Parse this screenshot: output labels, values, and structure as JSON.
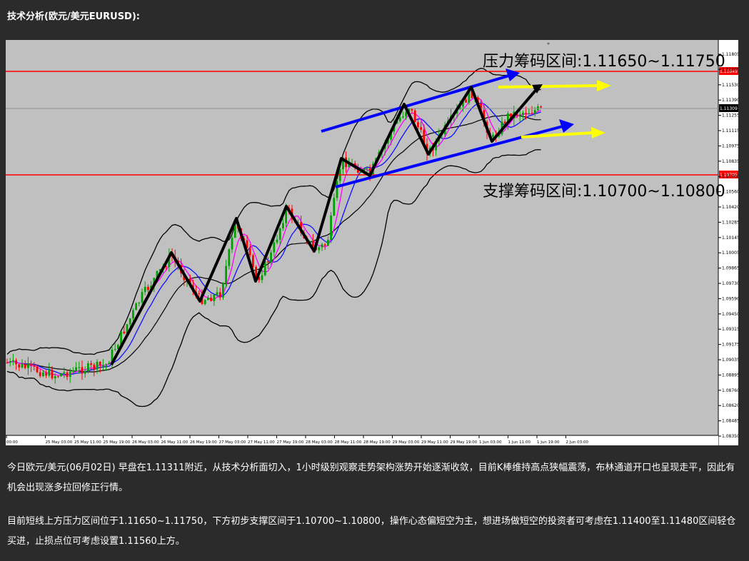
{
  "heading": "技术分析(欧元/美元EURUSD):",
  "chart": {
    "resistance_label": "压力筹码区间:1.11650~1.11750",
    "support_label": "支撑筹码区间:1.10700~1.10800",
    "resistance_level": "1.11649",
    "support_level": "1.10705",
    "current_price": "1.11309",
    "price_ticks": [
      "1.11805",
      "1.11665",
      "1.11530",
      "1.11390",
      "1.11255",
      "1.11115",
      "1.10975",
      "1.10835",
      "1.10700",
      "1.10560",
      "1.10420",
      "1.10285",
      "1.10145",
      "1.10005",
      "1.09865",
      "1.09730",
      "1.09590",
      "1.09450",
      "1.09315",
      "1.09175",
      "1.09035",
      "1.08895",
      "1.08760",
      "1.08620",
      "1.08485",
      "1.08350"
    ],
    "time_ticks": [
      "00:00",
      "25 May 03:00",
      "25 May 11:00",
      "25 May 19:00",
      "26 May 03:00",
      "26 May 11:00",
      "26 May 19:00",
      "27 May 03:00",
      "27 May 11:00",
      "27 May 19:00",
      "28 May 03:00",
      "28 May 11:00",
      "28 May 19:00",
      "29 May 03:00",
      "29 May 11:00",
      "29 May 19:00",
      "1 Jun 03:00",
      "1 Jun 11:00",
      "1 Jun 19:00",
      "2 Jun 03:00"
    ],
    "colors": {
      "background": "#c0c0c0",
      "level_line": "#ff0000",
      "bull_candle": "#00a000",
      "bear_candle": "#ff0000",
      "channel_arrow": "#0000ff",
      "target_arrow": "#ffff00",
      "zigzag": "#000000"
    }
  },
  "paragraphs": [
    "今日欧元/美元(06月02日) 早盘在1.11311附近，从技术分析面切入，1小时级别观察走势架构涨势开始逐渐收敛，目前K棒维持高点狭幅震荡，布林通道开口也呈现走平，因此有机会出现涨多拉回修正行情。",
    "目前短线上方压力区间位于1.11650~1.11750，下方初步支撑区间于1.10700~1.10800，操作心态偏短空为主，想进场做短空的投资者可考虑在1.11400至1.11480区间轻仓买进，止损点位可考虑设置1.11560上方。"
  ]
}
